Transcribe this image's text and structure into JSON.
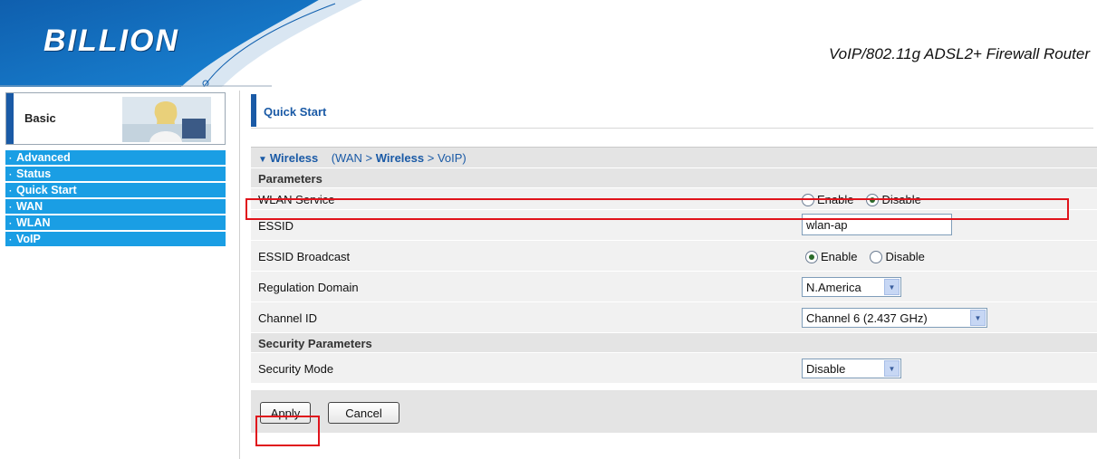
{
  "header": {
    "logo": "BILLION",
    "product_title": "VoIP/802.11g ADSL2+ Firewall Router"
  },
  "sidebar": {
    "mode_label": "Basic",
    "items": [
      {
        "label": "Advanced"
      },
      {
        "label": "Status"
      },
      {
        "label": "Quick Start"
      },
      {
        "label": "WAN"
      },
      {
        "label": "WLAN"
      },
      {
        "label": "VoIP"
      }
    ]
  },
  "main": {
    "page_title": "Quick Start",
    "breadcrumb": {
      "current": "Wireless",
      "open_paren": "(WAN",
      "sep1": ">",
      "step_current": "Wireless",
      "sep2": ">",
      "step_next": "VoIP)"
    },
    "parameters_label": "Parameters",
    "fields": {
      "wlan_service": {
        "label": "WLAN Service",
        "options": [
          "Enable",
          "Disable"
        ],
        "selected": "Disable"
      },
      "essid": {
        "label": "ESSID",
        "value": "wlan-ap"
      },
      "essid_broadcast": {
        "label": "ESSID Broadcast",
        "options": [
          "Enable",
          "Disable"
        ],
        "selected": "Enable"
      },
      "regulation_domain": {
        "label": "Regulation Domain",
        "value": "N.America"
      },
      "channel_id": {
        "label": "Channel ID",
        "value": "Channel 6 (2.437 GHz)"
      }
    },
    "security_label": "Security Parameters",
    "security_mode": {
      "label": "Security Mode",
      "value": "Disable"
    },
    "buttons": {
      "apply": "Apply",
      "cancel": "Cancel"
    }
  },
  "colors": {
    "menu_bg": "#1a9ee4",
    "accent": "#1a5aa6",
    "highlight": "#e0141c"
  }
}
